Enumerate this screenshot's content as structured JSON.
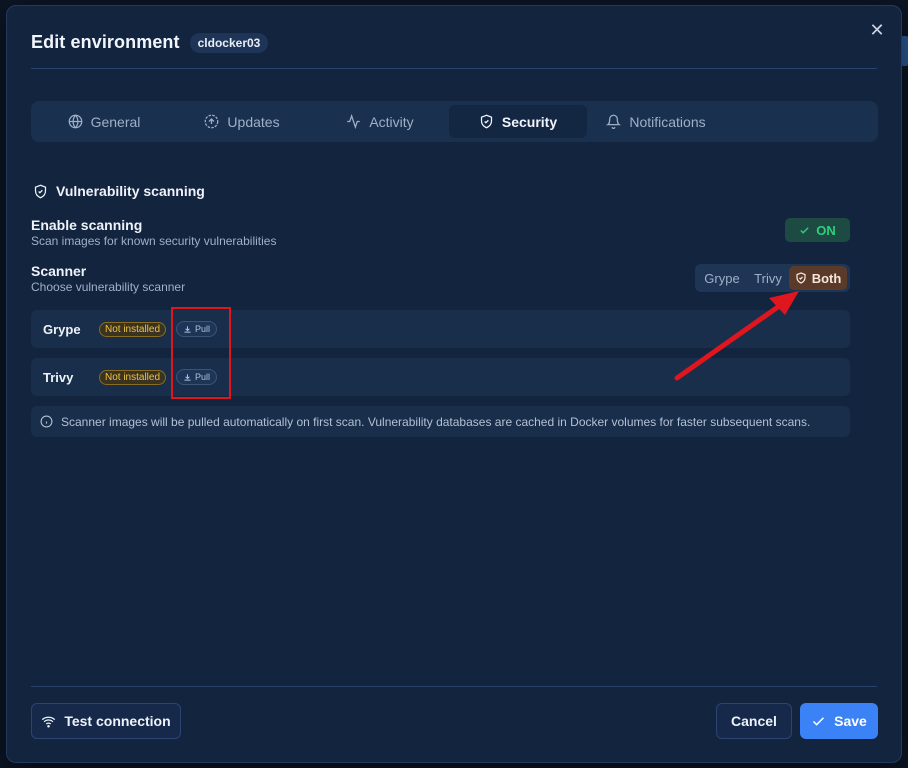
{
  "dialog": {
    "title": "Edit environment",
    "environment_name": "cldocker03",
    "close_glyph": "✕"
  },
  "tabs": [
    {
      "label": "General",
      "icon": "globe-icon"
    },
    {
      "label": "Updates",
      "icon": "circle-arrow-up-icon"
    },
    {
      "label": "Activity",
      "icon": "activity-icon"
    },
    {
      "label": "Security",
      "icon": "shield-check-icon",
      "active": true
    },
    {
      "label": "Notifications",
      "icon": "bell-icon"
    }
  ],
  "security": {
    "section_title": "Vulnerability scanning",
    "enable_scanning": {
      "label": "Enable scanning",
      "description": "Scan images for known security vulnerabilities",
      "state": "ON"
    },
    "scanner": {
      "label": "Scanner",
      "description": "Choose vulnerability scanner",
      "options": [
        "Grype",
        "Trivy",
        "Both"
      ],
      "selected": "Both"
    },
    "scanners": [
      {
        "name": "Grype",
        "status": "Not installed",
        "action": "Pull"
      },
      {
        "name": "Trivy",
        "status": "Not installed",
        "action": "Pull"
      }
    ],
    "info_text": "Scanner images will be pulled automatically on first scan. Vulnerability databases are cached in Docker volumes for faster subsequent scans."
  },
  "footer": {
    "test_connection": "Test connection",
    "cancel": "Cancel",
    "save": "Save"
  },
  "colors": {
    "modal_bg": "#13243f",
    "accent": "#3b82f6",
    "on_green": "#2fd07a",
    "warning_yellow": "#f2c046",
    "annotation_red": "#e0161e"
  }
}
